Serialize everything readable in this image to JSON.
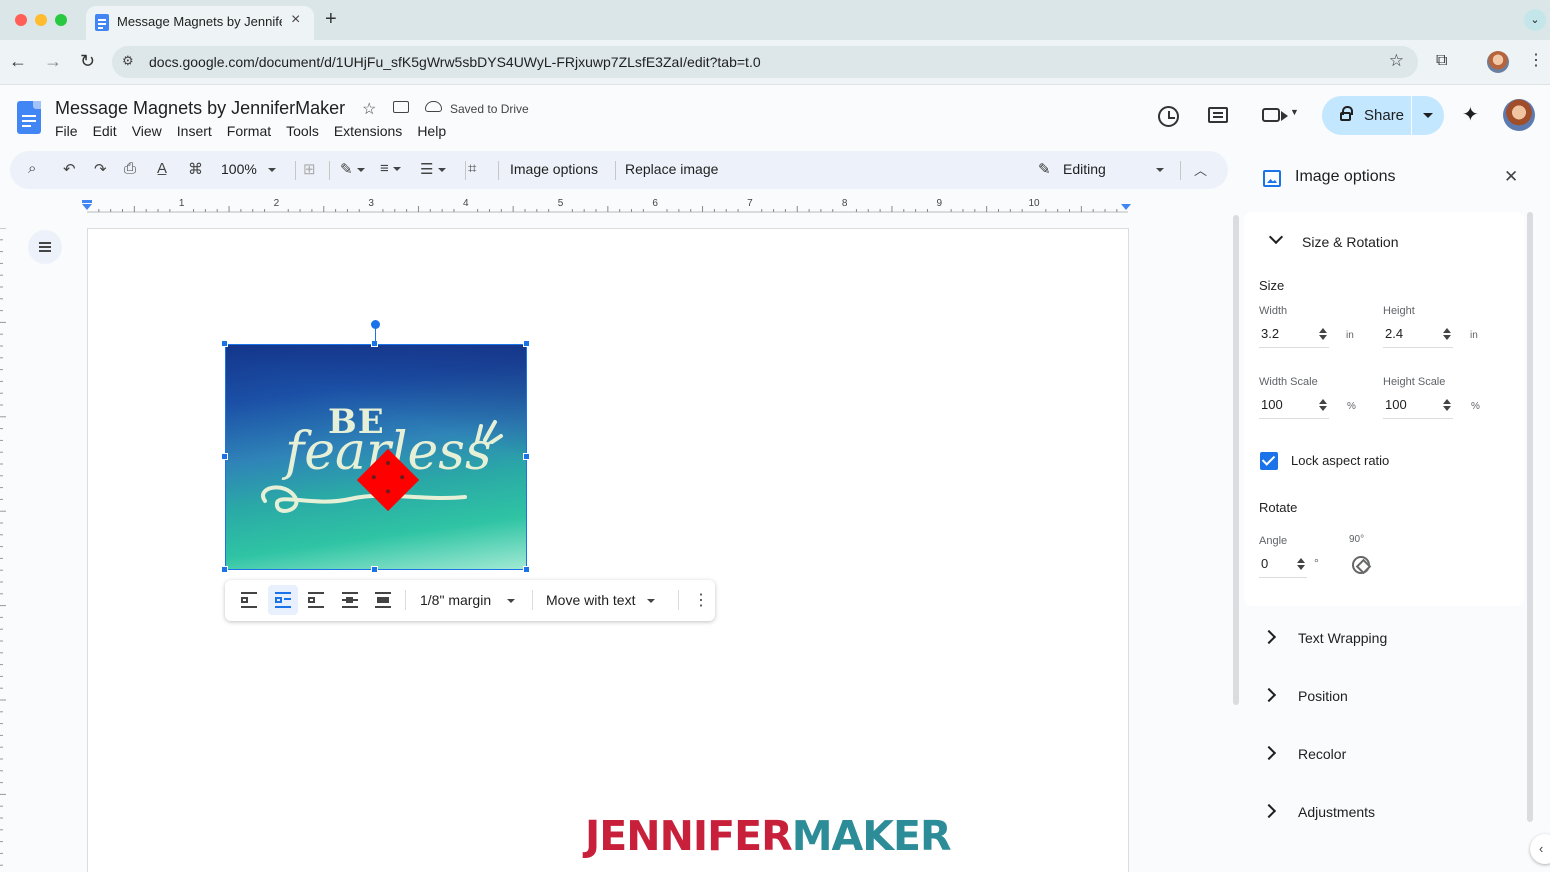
{
  "browser": {
    "tab_title": "Message Magnets by JenniferMaker",
    "url": "docs.google.com/document/d/1UHjFu_sfK5gWrw5sbDYS4UWyL-FRjxuwp7ZLsfE3ZaI/edit?tab=t.0",
    "traffic_lights": [
      "#ff5f57",
      "#febc2e",
      "#28c840"
    ]
  },
  "doc": {
    "title": "Message Magnets by JenniferMaker",
    "save_status": "Saved to Drive",
    "menu": [
      "File",
      "Edit",
      "View",
      "Insert",
      "Format",
      "Tools",
      "Extensions",
      "Help"
    ],
    "share_label": "Share"
  },
  "toolbar": {
    "zoom": "100%",
    "image_options": "Image options",
    "replace_image": "Replace image",
    "mode": "Editing"
  },
  "ruler": {
    "labels": [
      "1",
      "2",
      "3",
      "4",
      "5",
      "6",
      "7",
      "8",
      "9",
      "10"
    ]
  },
  "image": {
    "text_line1": "BE",
    "text_line2": "fearless"
  },
  "image_toolbar": {
    "margin": "1/8\" margin",
    "position_mode": "Move with text"
  },
  "watermark": {
    "part1": "JENNIFER",
    "part2": "MAKER"
  },
  "side_panel": {
    "title": "Image options",
    "size_rotation": {
      "label": "Size & Rotation",
      "size_heading": "Size",
      "width_label": "Width",
      "width_value": "3.2",
      "height_label": "Height",
      "height_value": "2.4",
      "unit_in": "in",
      "width_scale_label": "Width Scale",
      "width_scale_value": "100",
      "height_scale_label": "Height Scale",
      "height_scale_value": "100",
      "unit_pct": "%",
      "lock_aspect_label": "Lock aspect ratio",
      "lock_aspect_checked": true,
      "rotate_heading": "Rotate",
      "angle_label": "Angle",
      "angle_value": "0",
      "degree_symbol": "°",
      "rotate_90_label": "90°"
    },
    "sections": [
      "Text Wrapping",
      "Position",
      "Recolor",
      "Adjustments"
    ]
  }
}
